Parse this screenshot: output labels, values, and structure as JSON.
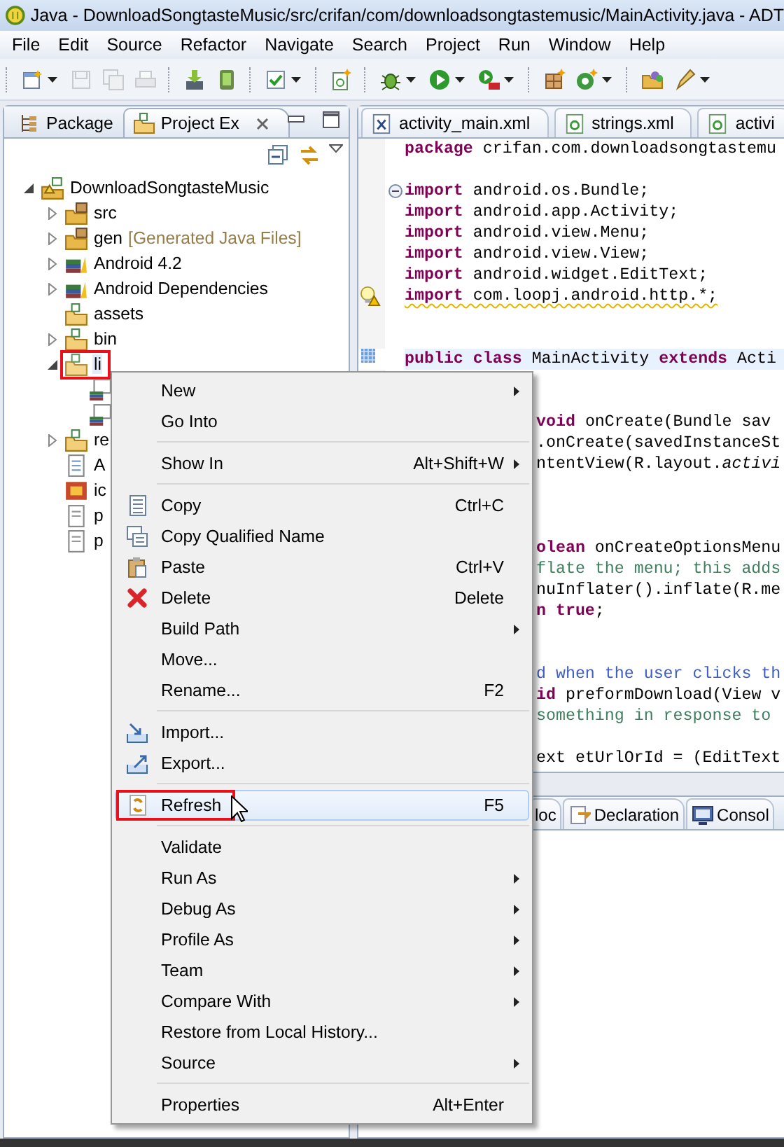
{
  "window": {
    "title": "Java - DownloadSongtasteMusic/src/crifan/com/downloadsongtastemusic/MainActivity.java - ADT"
  },
  "menu_bar": [
    "File",
    "Edit",
    "Source",
    "Refactor",
    "Navigate",
    "Search",
    "Project",
    "Run",
    "Window",
    "Help"
  ],
  "toolbar": [
    [
      {
        "kind": "new",
        "disabled": false,
        "dropdown": true
      },
      {
        "kind": "save",
        "disabled": true,
        "dropdown": false
      },
      {
        "kind": "save-all",
        "disabled": true,
        "dropdown": false
      },
      {
        "kind": "print",
        "disabled": true,
        "dropdown": false
      }
    ],
    [
      {
        "kind": "download",
        "disabled": false,
        "dropdown": false
      },
      {
        "kind": "device",
        "disabled": false,
        "dropdown": false
      }
    ],
    [
      {
        "kind": "check",
        "disabled": false,
        "dropdown": true
      }
    ],
    [
      {
        "kind": "new-file",
        "disabled": false,
        "dropdown": false
      }
    ],
    [
      {
        "kind": "bug",
        "disabled": false,
        "dropdown": true
      },
      {
        "kind": "run",
        "disabled": false,
        "dropdown": true
      },
      {
        "kind": "run-tool",
        "disabled": false,
        "dropdown": true
      }
    ],
    [
      {
        "kind": "new-package",
        "disabled": false,
        "dropdown": false
      },
      {
        "kind": "new-class",
        "disabled": false,
        "dropdown": true
      }
    ],
    [
      {
        "kind": "open-folder",
        "disabled": false,
        "dropdown": false
      },
      {
        "kind": "pen",
        "disabled": false,
        "dropdown": true
      }
    ]
  ],
  "left_panel": {
    "tabs": [
      {
        "label": "Package",
        "kind": "hierarchy",
        "selected": false,
        "closable": false
      },
      {
        "label": "Project Ex",
        "kind": "folder",
        "selected": true,
        "closable": true
      }
    ],
    "tree": [
      {
        "label": "DownloadSongtasteMusic",
        "kind": "project",
        "expanded": true,
        "selected": false,
        "children": [
          {
            "label": "src",
            "kind": "source-folder",
            "expanded": false,
            "selected": false
          },
          {
            "label": "gen",
            "decoration": "[Generated Java Files]",
            "kind": "source-folder",
            "expanded": false,
            "selected": false
          },
          {
            "label": "Android 4.2",
            "kind": "library",
            "expanded": false,
            "selected": false
          },
          {
            "label": "Android Dependencies",
            "kind": "library",
            "expanded": false,
            "selected": false
          },
          {
            "label": "assets",
            "kind": "folder",
            "selected": false
          },
          {
            "label": "bin",
            "kind": "folder",
            "expanded": false,
            "selected": false
          },
          {
            "label": "li",
            "kind": "folder",
            "expanded": true,
            "selected": true,
            "outlined": true,
            "children": [
              {
                "kind": "jar",
                "selected": false
              },
              {
                "kind": "jar",
                "selected": false
              }
            ]
          },
          {
            "label": "re",
            "kind": "folder",
            "expanded": false,
            "selected": false
          },
          {
            "label": "A",
            "kind": "xml-file",
            "selected": false
          },
          {
            "label": "ic",
            "kind": "image",
            "selected": false
          },
          {
            "label": "p",
            "kind": "file",
            "selected": false
          },
          {
            "label": "p",
            "kind": "file",
            "selected": false
          }
        ]
      }
    ]
  },
  "editor": {
    "tabs": [
      {
        "label": "activity_main.xml",
        "kind": "layout-xml",
        "selected": false
      },
      {
        "label": "strings.xml",
        "kind": "android-xml",
        "selected": false
      },
      {
        "label": "activi",
        "kind": "android-xml",
        "selected": false
      }
    ],
    "lines": [
      {
        "kind": "code",
        "text": "**package** crifan.com.downloadsongtastemu"
      },
      {
        "kind": "blank"
      },
      {
        "kind": "code",
        "text": "**import** android.os.Bundle;",
        "fold": true
      },
      {
        "kind": "code",
        "text": "**import** android.app.Activity;"
      },
      {
        "kind": "code",
        "text": "**import** android.view.Menu;"
      },
      {
        "kind": "code",
        "text": "**import** android.view.View;"
      },
      {
        "kind": "code",
        "text": "**import** android.widget.EditText;"
      },
      {
        "kind": "code",
        "text": "**import** com.loopj.android.http.*;",
        "warning": true
      },
      {
        "kind": "blank"
      },
      {
        "kind": "blank"
      },
      {
        "kind": "code",
        "text": "**public class** MainActivity **extends** Acti",
        "current": true
      },
      {
        "kind": "blank"
      },
      {
        "kind": "blank"
      },
      {
        "kind": "clipped",
        "text": "**void** onCreate(Bundle sav"
      },
      {
        "kind": "clipped",
        "text": ".onCreate(savedInstanceSt"
      },
      {
        "kind": "clipped",
        "text": "ntentView(R.layout.*activi*"
      },
      {
        "kind": "blank"
      },
      {
        "kind": "blank"
      },
      {
        "kind": "blank"
      },
      {
        "kind": "clipped",
        "text": "**olean** onCreateOptionsMenu"
      },
      {
        "kind": "comment",
        "text": "flate the menu; this adds"
      },
      {
        "kind": "clipped",
        "text": "nuInflater().inflate(R.me"
      },
      {
        "kind": "clipped",
        "text": "**n true**;"
      },
      {
        "kind": "blank"
      },
      {
        "kind": "blank"
      },
      {
        "kind": "javadoc",
        "text": "d when the user clicks th"
      },
      {
        "kind": "clipped",
        "text": "**id** preformDownload(View v"
      },
      {
        "kind": "comment",
        "text": "something in response to"
      },
      {
        "kind": "blank"
      },
      {
        "kind": "clipped",
        "text": "ext etUrlOrId = (EditText"
      }
    ]
  },
  "bottom_panel": {
    "tabs": [
      {
        "label": "loc",
        "kind": "none",
        "selected": false
      },
      {
        "label": "Declaration",
        "kind": "declaration",
        "selected": false
      },
      {
        "label": "Consol",
        "kind": "console",
        "selected": false
      }
    ]
  },
  "context_menu": {
    "groups": [
      [
        {
          "label": "New",
          "submenu": true
        },
        {
          "label": "Go Into"
        }
      ],
      [
        {
          "label": "Show In",
          "shortcut": "Alt+Shift+W",
          "submenu": true
        }
      ],
      [
        {
          "label": "Copy",
          "shortcut": "Ctrl+C",
          "kind": "copy"
        },
        {
          "label": "Copy Qualified Name",
          "kind": "copy-qualified"
        },
        {
          "label": "Paste",
          "shortcut": "Ctrl+V",
          "kind": "paste"
        },
        {
          "label": "Delete",
          "shortcut": "Delete",
          "kind": "delete"
        },
        {
          "label": "Build Path",
          "submenu": true
        },
        {
          "label": "Move..."
        },
        {
          "label": "Rename...",
          "shortcut": "F2"
        }
      ],
      [
        {
          "label": "Import...",
          "kind": "import"
        },
        {
          "label": "Export...",
          "kind": "export"
        }
      ],
      [
        {
          "label": "Refresh",
          "shortcut": "F5",
          "kind": "refresh",
          "highlighted": true,
          "outlined": true
        }
      ],
      [
        {
          "label": "Validate"
        },
        {
          "label": "Run As",
          "submenu": true
        },
        {
          "label": "Debug As",
          "submenu": true
        },
        {
          "label": "Profile As",
          "submenu": true
        },
        {
          "label": "Team",
          "submenu": true
        },
        {
          "label": "Compare With",
          "submenu": true
        },
        {
          "label": "Restore from Local History..."
        },
        {
          "label": "Source",
          "submenu": true
        }
      ],
      [
        {
          "label": "Properties",
          "shortcut": "Alt+Enter"
        }
      ]
    ]
  }
}
